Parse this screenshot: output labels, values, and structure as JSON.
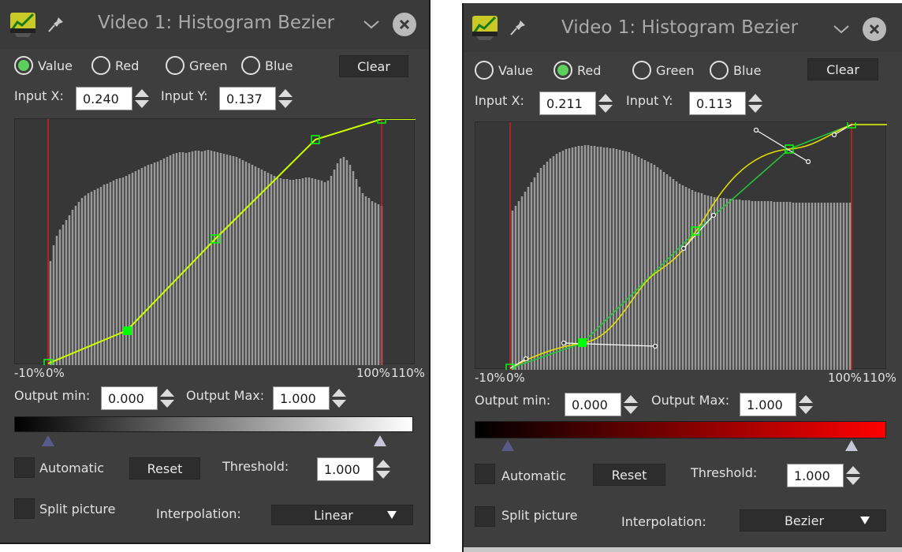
{
  "windows": [
    {
      "title": "Video 1: Histogram Bezier",
      "channels": [
        "Value",
        "Red",
        "Green",
        "Blue"
      ],
      "selected_channel": "Value",
      "clear_label": "Clear",
      "input_x_label": "Input X:",
      "input_x": "0.240",
      "input_y_label": "Input Y:",
      "input_y": "0.137",
      "axis": {
        "left": "-10%",
        "zero": "0%",
        "hundred": "100%",
        "max": "110%"
      },
      "output_min_label": "Output min:",
      "output_min": "0.000",
      "output_max_label": "Output Max:",
      "output_max": "1.000",
      "gradient_color": "#ffffff",
      "automatic_label": "Automatic",
      "reset_label": "Reset",
      "threshold_label": "Threshold:",
      "threshold": "1.000",
      "split_label": "Split picture",
      "interpolation_label": "Interpolation:",
      "interpolation": "Linear"
    },
    {
      "title": "Video 1: Histogram Bezier",
      "channels": [
        "Value",
        "Red",
        "Green",
        "Blue"
      ],
      "selected_channel": "Red",
      "clear_label": "Clear",
      "input_x_label": "Input X:",
      "input_x": "0.211",
      "input_y_label": "Input Y:",
      "input_y": "0.113",
      "axis": {
        "left": "-10%",
        "zero": "0%",
        "hundred": "100%",
        "max": "110%"
      },
      "output_min_label": "Output min:",
      "output_min": "0.000",
      "output_max_label": "Output Max:",
      "output_max": "1.000",
      "gradient_color": "#ff0000",
      "automatic_label": "Automatic",
      "reset_label": "Reset",
      "threshold_label": "Threshold:",
      "threshold": "1.000",
      "split_label": "Split picture",
      "interpolation_label": "Interpolation:",
      "interpolation": "Bezier"
    }
  ],
  "icons": {
    "app": "histogram-app-icon",
    "pin": "pin-icon",
    "chevron": "chevron-down-icon",
    "close": "close-icon",
    "spin_up": "spin-up-icon",
    "spin_down": "spin-down-icon",
    "dropdown": "dropdown-arrow-icon"
  },
  "colors": {
    "curve": "#ccff00",
    "control_point": "#00ff00",
    "handle": "#ffffff",
    "histogram": "#9a9a9a",
    "range_lines": "#d02020",
    "window_bg": "#3e3e3e"
  }
}
